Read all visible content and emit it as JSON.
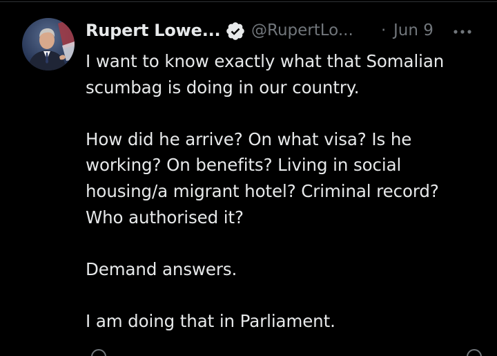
{
  "author": {
    "name": "Rupert Lowe...",
    "handle": "@RupertLo...",
    "separator": "·",
    "date": "Jun 9",
    "verified": true,
    "verified_color": "#1d9bf0"
  },
  "tweet": {
    "paragraphs": [
      [
        "I want to know exactly what that Somalian",
        "scumbag is doing in our country."
      ],
      [
        "How did he arrive? On what visa? Is he",
        "working? On benefits? Living in social",
        "housing/a migrant hotel? Criminal record?",
        "Who authorised it?"
      ],
      [
        "Demand answers."
      ],
      [
        "I am doing that in Parliament."
      ]
    ]
  },
  "icons": {
    "avatar": "profile-photo",
    "verified": "verified-badge-icon",
    "more": "more-options-icon"
  },
  "colors": {
    "background": "#000000",
    "text": "#e7e9ea",
    "secondary": "#71767b",
    "divider": "#2f3336"
  }
}
